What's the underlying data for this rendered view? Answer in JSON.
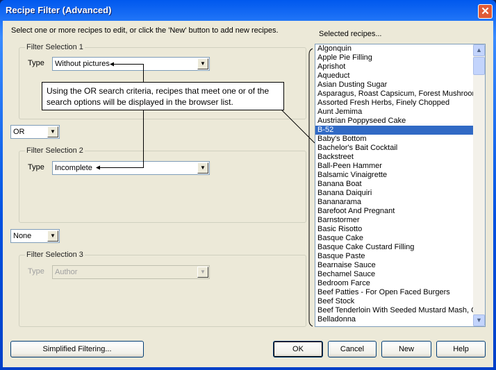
{
  "window": {
    "title": "Recipe Filter (Advanced)",
    "close_icon": "close-icon"
  },
  "instructions": "Select one or more recipes to edit, or click the 'New' button to add new recipes.",
  "selected_label": "Selected recipes...",
  "filter1": {
    "label": "Filter Selection 1",
    "type_label": "Type",
    "value": "Without pictures"
  },
  "operator1": "OR",
  "filter2": {
    "label": "Filter Selection 2",
    "type_label": "Type",
    "value": "Incomplete"
  },
  "operator2": "None",
  "filter3": {
    "label": "Filter Selection 3",
    "type_label": "Type",
    "value": "Author",
    "disabled": true
  },
  "callout": "Using the OR search criteria, recipes that meet one or of the search options will be displayed in the browser list.",
  "recipes": [
    "Algonquin",
    "Apple Pie Filling",
    "Aprishot",
    "Aqueduct",
    "Asian Dusting Sugar",
    "Asparagus, Roast Capsicum, Forest Mushroom",
    "Assorted Fresh Herbs, Finely Chopped",
    "Aunt Jemima",
    "Austrian Poppyseed Cake",
    "B-52",
    "Baby's Bottom",
    "Bachelor's Bait Cocktail",
    "Backstreet",
    "Ball-Peen Hammer",
    "Balsamic Vinaigrette",
    "Banana Boat",
    "Banana Daiquiri",
    "Bananarama",
    "Barefoot And Pregnant",
    "Barnstormer",
    "Basic Risotto",
    "Basque Cake",
    "Basque Cake Custard Filling",
    "Basque Paste",
    "Bearnaise Sauce",
    "Bechamel Sauce",
    "Bedroom Farce",
    "Beef Patties - For Open Faced Burgers",
    "Beef Stock",
    "Beef Tenderloin With Seeded Mustard Mash, O",
    "Belladonna"
  ],
  "selected_recipe": "B-52",
  "buttons": {
    "simplified": "Simplified Filtering...",
    "ok": "OK",
    "cancel": "Cancel",
    "new": "New",
    "help": "Help"
  }
}
